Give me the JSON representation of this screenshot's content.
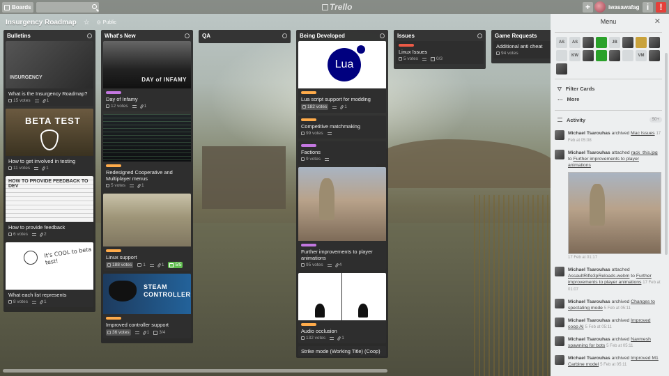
{
  "topbar": {
    "boards_label": "Boards",
    "logo_text": "Trello",
    "add_label": "+",
    "username": "iwasawafag"
  },
  "board": {
    "title": "Insurgency Roadmap",
    "visibility": "Public"
  },
  "lists": [
    {
      "name": "Bulletins",
      "cards": [
        {
          "title": "What is the Insurgency Roadmap?",
          "image_text": "INSURGENCY",
          "votes": "15 votes",
          "attachments": "1"
        },
        {
          "title": "How to get involved in testing",
          "image_text": "BETA TEST",
          "votes": "11 votes",
          "attachments": "1"
        },
        {
          "title": "How to provide feedback",
          "image_text": "HOW TO PROVIDE FEEDBACK TO DEV",
          "votes": "6 votes",
          "attachments": "2"
        },
        {
          "title": "What each list represents",
          "image_text": "It's COOL to beta test!",
          "votes": "8 votes",
          "attachments": "1"
        }
      ]
    },
    {
      "name": "What's New",
      "cards": [
        {
          "title": "Day of Infamy",
          "image_text": "DAY of INFAMY",
          "votes": "12 votes",
          "attachments": "1"
        },
        {
          "title": "Redesigned Cooperative and Multiplayer menus",
          "votes": "5 votes",
          "attachments": "1"
        },
        {
          "title": "Linux support",
          "votes": "188 votes",
          "comments": "1",
          "attachments": "1",
          "checklist": "5/5"
        },
        {
          "title": "Improved controller support",
          "image_text": "STEAM CONTROLLER",
          "votes": "36 votes",
          "attachments": "1",
          "checklist": "3/4"
        }
      ]
    },
    {
      "name": "QA",
      "cards": []
    },
    {
      "name": "Being Developed",
      "cards": [
        {
          "title": "Lua script support for modding",
          "image_text": "Lua",
          "votes": "182 votes",
          "attachments": "1"
        },
        {
          "title": "Competitive matchmaking",
          "votes": "99 votes"
        },
        {
          "title": "Factions",
          "votes": "9 votes"
        },
        {
          "title": "Further improvements to player animations",
          "votes": "95 votes",
          "attachments": "4"
        },
        {
          "title": "Audio occlusion",
          "votes": "132 votes",
          "attachments": "1"
        },
        {
          "title": "Strike mode (Working Title) (Coop)"
        }
      ]
    },
    {
      "name": "Issues",
      "cards": [
        {
          "title": "Linux Issues",
          "votes": "5 votes",
          "checklist": "0/3"
        }
      ]
    },
    {
      "name": "Game Requests",
      "cards": [
        {
          "title": "Additional anti cheat",
          "votes": "94 votes"
        }
      ]
    }
  ],
  "menu": {
    "title": "Menu",
    "members": [
      "AS",
      "AS",
      "",
      "",
      "JB",
      "",
      "",
      "",
      "",
      "KW",
      "",
      "",
      "",
      "",
      "VM",
      "",
      ""
    ],
    "filter_label": "Filter Cards",
    "more_label": "More",
    "activity_label": "Activity",
    "activity_more": "50+",
    "activities": [
      {
        "who": "Michael Tsarouhas",
        "action": "archived",
        "target": "Mac Issues",
        "time": "17 Feb at 05:08"
      },
      {
        "who": "Michael Tsarouhas",
        "action": "attached",
        "target": "rack_this.jpg",
        "prep": "to",
        "target2": "Further improvements to player animations",
        "time": "17 Feb at 01:17"
      },
      {
        "who": "Michael Tsarouhas",
        "action": "attached",
        "target": "AssaultRifle3pReloads.webm",
        "prep": "to",
        "target2": "Further improvements to player animations",
        "time": "17 Feb at 01:07"
      },
      {
        "who": "Michael Tsarouhas",
        "action": "archived",
        "target": "Changes to spectating mode",
        "time": "5 Feb at 05:11"
      },
      {
        "who": "Michael Tsarouhas",
        "action": "archived",
        "target": "Improved coop AI",
        "time": "5 Feb at 05:11"
      },
      {
        "who": "Michael Tsarouhas",
        "action": "archived",
        "target": "Navmesh spawning for bots",
        "time": "5 Feb at 05:11"
      },
      {
        "who": "Michael Tsarouhas",
        "action": "archived",
        "target": "Improved M1 Carbine model",
        "time": "5 Feb at 05:11"
      }
    ]
  },
  "colors": {
    "label_purple": "#c377e0",
    "label_orange": "#ffab4a",
    "label_red": "#eb5a46",
    "notification": "#e4403a",
    "checklist_done": "#61bd4f"
  }
}
